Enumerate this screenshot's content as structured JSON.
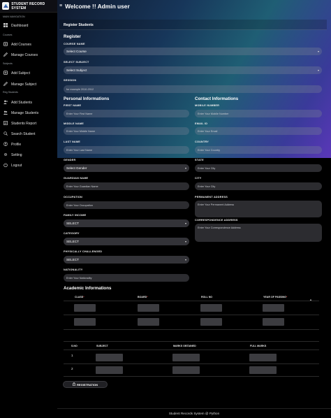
{
  "brand": {
    "title": "STUDENT RECORD SYSTEM"
  },
  "header": {
    "title": "Welcome !! Admin user"
  },
  "sidebar": {
    "sections": [
      {
        "label": "MAIN NAVIGATION"
      },
      {
        "label": "Courses"
      },
      {
        "label": "Subjects"
      },
      {
        "label": "Reg Students"
      }
    ],
    "items": [
      {
        "label": "Dashboard",
        "icon": "dashboard-icon"
      },
      {
        "label": "Add Courses",
        "icon": "add-icon"
      },
      {
        "label": "Manage Courses",
        "icon": "manage-icon"
      },
      {
        "label": "Add Subject",
        "icon": "add-icon"
      },
      {
        "label": "Manage Subject",
        "icon": "manage-icon"
      },
      {
        "label": "Add Students",
        "icon": "add-user-icon"
      },
      {
        "label": "Manage Students",
        "icon": "users-icon"
      },
      {
        "label": "Students Report",
        "icon": "report-icon"
      },
      {
        "label": "Search Student",
        "icon": "search-icon"
      },
      {
        "label": "Profile",
        "icon": "profile-icon"
      },
      {
        "label": "Setting",
        "icon": "gear-icon"
      },
      {
        "label": "Logout",
        "icon": "logout-icon"
      }
    ]
  },
  "panel": {
    "title": "Register Students"
  },
  "form": {
    "register_heading": "Register",
    "course": {
      "label": "COURSE NAME",
      "value": "Select Course"
    },
    "subject": {
      "label": "SELECT SUBJECT",
      "value": "Select Subject"
    },
    "session": {
      "label": "SESSION",
      "placeholder": "for example 2010-2012"
    },
    "personal_heading": "Personal Informations",
    "contact_heading": "Contact Informations",
    "first_name": {
      "label": "FIRST NAME",
      "placeholder": "Enter Your First Name"
    },
    "middle_name": {
      "label": "MIDDLE NAME",
      "placeholder": "Enter Your Middle Name"
    },
    "last_name": {
      "label": "LAST NAME",
      "placeholder": "Enter Your Last Name"
    },
    "gender": {
      "label": "GENDER",
      "value": "Select Gender"
    },
    "guardian": {
      "label": "GUARDIAN NAME",
      "placeholder": "Enter Your Guardian Name"
    },
    "occupation": {
      "label": "OCCUPATION",
      "placeholder": "Enter Your Occupation"
    },
    "income": {
      "label": "FAMILY INCOME",
      "value": "SELECT"
    },
    "category": {
      "label": "CATEGORY",
      "value": "SELECT"
    },
    "challenged": {
      "label": "PHYSICALLY CHALLENGED",
      "value": "SELECT"
    },
    "nationality": {
      "label": "NATIONALITY",
      "placeholder": "Enter Your Nationality"
    },
    "mobile": {
      "label": "MOBILE NUMBER",
      "placeholder": "Enter Your Mobile Number"
    },
    "email": {
      "label": "EMAIL ID",
      "placeholder": "Enter Your Email"
    },
    "country": {
      "label": "COUNTRY",
      "placeholder": "Enter Your Country"
    },
    "state": {
      "label": "STATE",
      "placeholder": "Enter Your City"
    },
    "city": {
      "label": "CITY",
      "placeholder": "Enter Your City"
    },
    "permanent": {
      "label": "PERMANENT ADDRESS",
      "placeholder": "Enter Your Permanent Address"
    },
    "correspondence": {
      "label": "CORRESPONDENCE ADDRESS",
      "placeholder": "Enter Your Correspondence Address"
    }
  },
  "academic": {
    "heading": "Academic Informations",
    "columns": [
      "CLASS",
      "BOARD",
      "ROLL NO",
      "YEAR OF PASSING"
    ],
    "required_mark": "*"
  },
  "subjects_table": {
    "columns": [
      "S.NO",
      "SUBJECT",
      "MARKS OBTAINED",
      "FULL MARKS"
    ],
    "rows": [
      "1",
      "2"
    ]
  },
  "submit": {
    "label": "REGISTRATION",
    "icon": "lock-icon"
  },
  "footer": {
    "text": "Student Records System @ Python"
  }
}
